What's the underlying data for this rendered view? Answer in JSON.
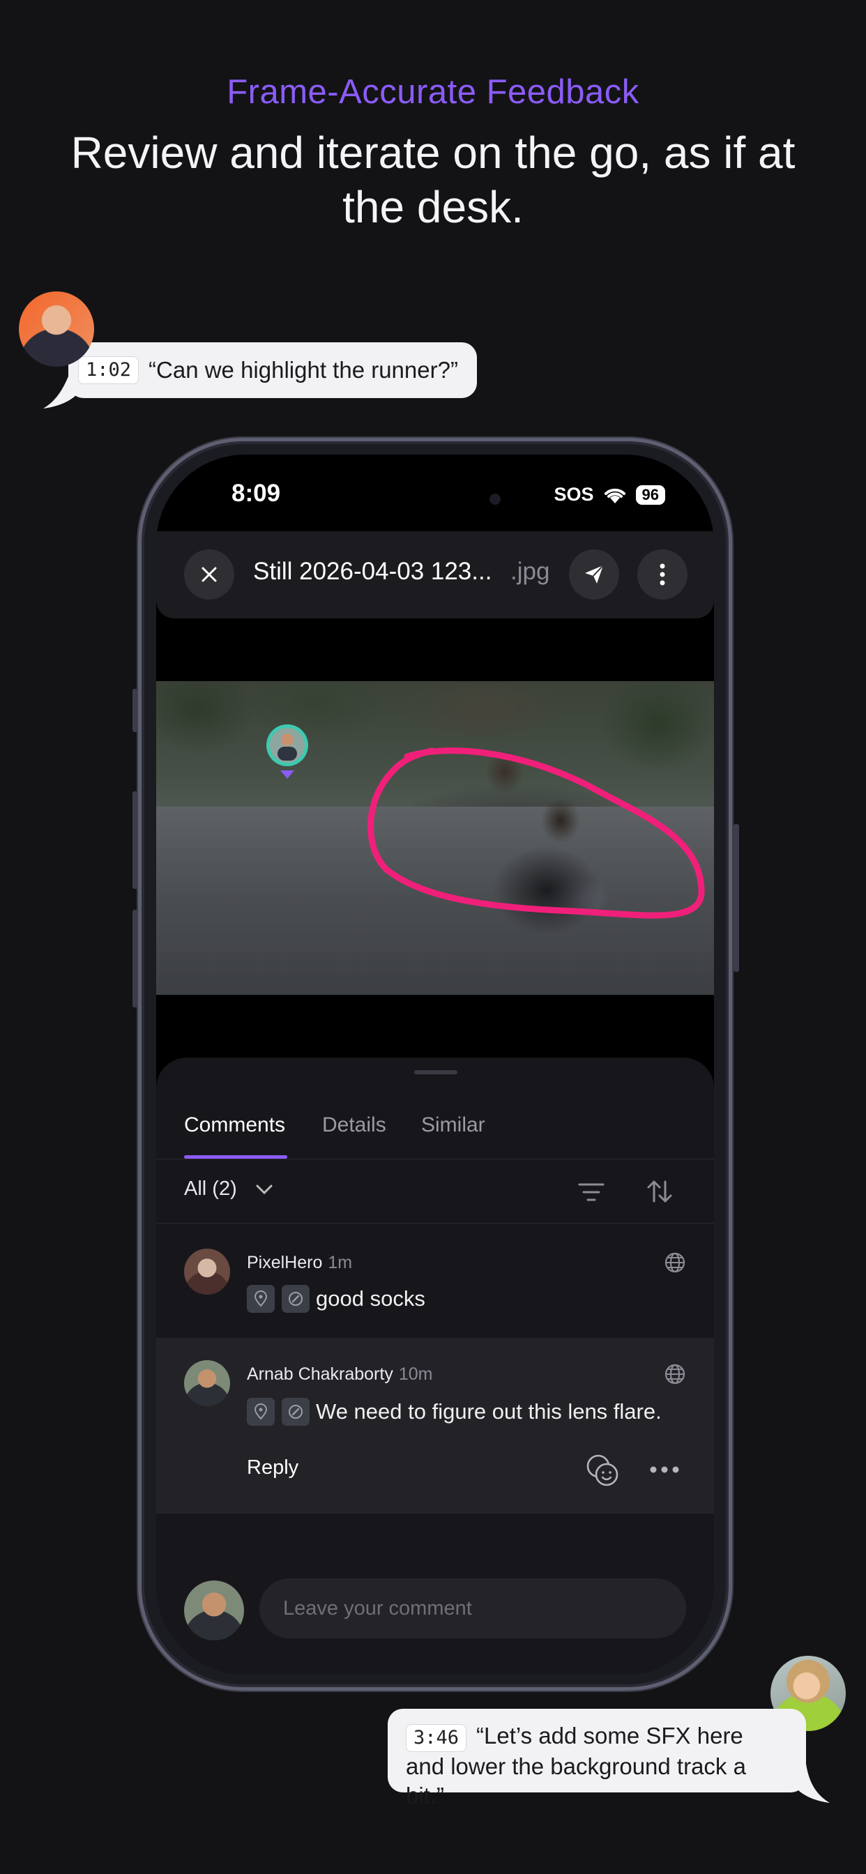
{
  "headline": {
    "eyebrow": "Frame-Accurate Feedback",
    "title": "Review and iterate on the go, as if at the desk."
  },
  "floating_comments": [
    {
      "timecode": "1:02",
      "text": "“Can we highlight the runner?”"
    },
    {
      "timecode": "3:46",
      "text_line1": "“Let’s add some SFX here",
      "text_line2": "and lower the background track a bit.”"
    }
  ],
  "status_bar": {
    "time": "8:09",
    "carrier": "SOS",
    "battery": "96"
  },
  "viewer": {
    "file_name": "Still 2026-04-03 123...",
    "file_ext": ".jpg",
    "icons": {
      "close": "close-icon",
      "share": "send-icon",
      "more": "more-vertical-icon"
    },
    "annotation_color": "#f0207a"
  },
  "panel": {
    "tabs": [
      {
        "label": "Comments",
        "active": true
      },
      {
        "label": "Details",
        "active": false
      },
      {
        "label": "Similar",
        "active": false
      }
    ],
    "filter": {
      "label": "All (2)"
    },
    "accent": "#8b5cf6"
  },
  "comments": [
    {
      "author": "PixelHero",
      "time": "1m",
      "text": "good socks"
    },
    {
      "author": "Arnab Chakraborty",
      "time": "10m",
      "text": "We need to figure out this lens flare.",
      "reply_label": "Reply",
      "selected": true
    }
  ],
  "composer": {
    "placeholder": "Leave your comment"
  }
}
